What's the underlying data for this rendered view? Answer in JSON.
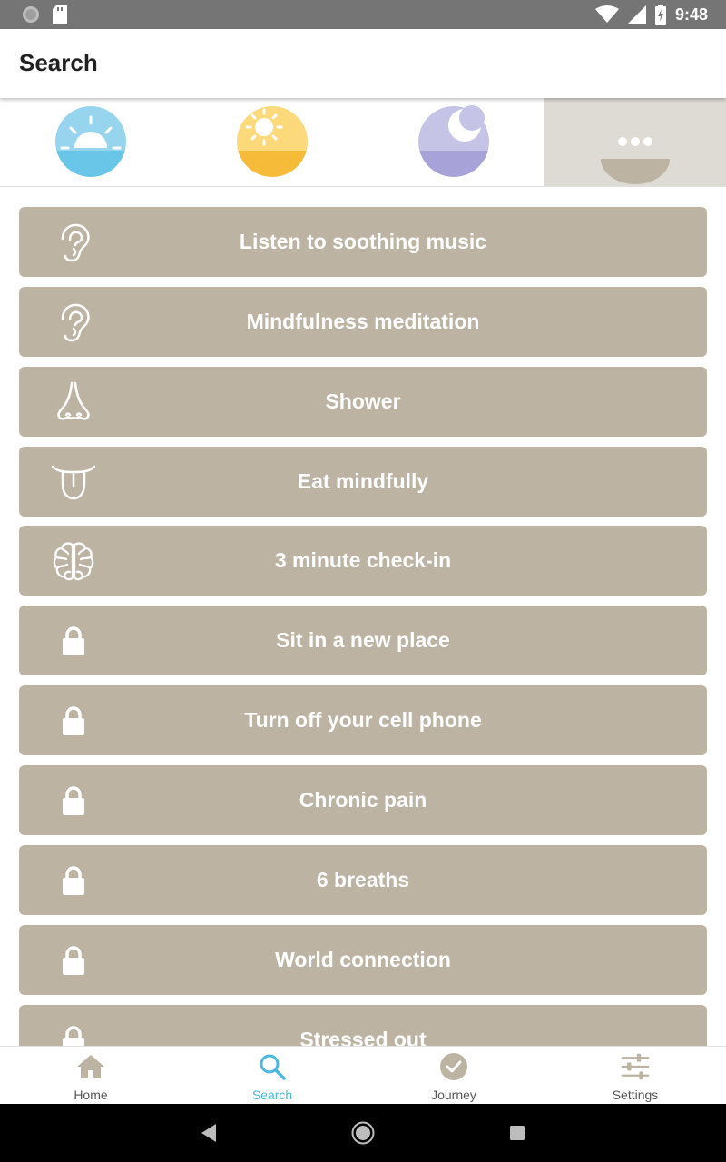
{
  "status_bar": {
    "time": "9:48"
  },
  "app_bar": {
    "title": "Search"
  },
  "time_of_day_tabs": [
    {
      "name": "sunrise",
      "icon": "sunrise-icon",
      "colors": [
        "#97d5ef",
        "#6ac6e9"
      ],
      "selected": false
    },
    {
      "name": "day",
      "icon": "sun-icon",
      "colors": [
        "#fcd97a",
        "#f6bc39"
      ],
      "selected": false
    },
    {
      "name": "night",
      "icon": "moon-icon",
      "colors": [
        "#c6c4e6",
        "#a7a2d7"
      ],
      "selected": false
    },
    {
      "name": "more",
      "icon": "more-dots-icon",
      "colors": [
        "#dedbd5",
        "#bcb3a3"
      ],
      "selected": true
    }
  ],
  "activities": [
    {
      "label": "Listen to soothing music",
      "icon": "ear-icon"
    },
    {
      "label": "Mindfulness meditation",
      "icon": "ear-icon"
    },
    {
      "label": "Shower",
      "icon": "nose-icon"
    },
    {
      "label": "Eat mindfully",
      "icon": "tongue-icon"
    },
    {
      "label": "3 minute check-in",
      "icon": "brain-icon"
    },
    {
      "label": "Sit in a new place",
      "icon": "lock-icon"
    },
    {
      "label": "Turn off your cell phone",
      "icon": "lock-icon"
    },
    {
      "label": "Chronic pain",
      "icon": "lock-icon"
    },
    {
      "label": "6 breaths",
      "icon": "lock-icon"
    },
    {
      "label": "World connection",
      "icon": "lock-icon"
    },
    {
      "label": "Stressed out",
      "icon": "lock-icon"
    }
  ],
  "bottom_nav": [
    {
      "label": "Home",
      "icon": "home-icon",
      "active": false
    },
    {
      "label": "Search",
      "icon": "search-icon",
      "active": true
    },
    {
      "label": "Journey",
      "icon": "checkmark-circle-icon",
      "active": false
    },
    {
      "label": "Settings",
      "icon": "sliders-icon",
      "active": false
    }
  ],
  "colors": {
    "item_background": "#bcb3a3",
    "accent": "#4ab8e0",
    "status_bar": "#757575"
  }
}
